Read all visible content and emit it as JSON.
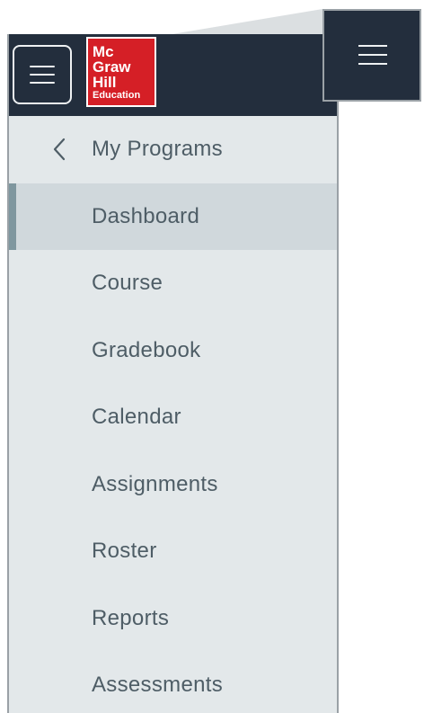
{
  "header": {
    "menu_icon": "hamburger-menu-icon",
    "logo": {
      "line1": "Mc",
      "line2": "Graw",
      "line3": "Hill",
      "line4": "Education",
      "color": "#d51f26"
    },
    "background": "#232e3d"
  },
  "nav": {
    "back": {
      "icon": "chevron-left-icon",
      "label": "My Programs"
    },
    "items": [
      {
        "label": "Dashboard",
        "active": true
      },
      {
        "label": "Course",
        "active": false
      },
      {
        "label": "Gradebook",
        "active": false
      },
      {
        "label": "Calendar",
        "active": false
      },
      {
        "label": "Assignments",
        "active": false
      },
      {
        "label": "Roster",
        "active": false
      },
      {
        "label": "Reports",
        "active": false
      },
      {
        "label": "Assessments",
        "active": false
      }
    ]
  },
  "callout": {
    "icon": "hamburger-menu-icon"
  },
  "colors": {
    "sidebar_bg": "#e3e8ea",
    "active_bg": "#d0d8dc",
    "active_indicator": "#7f979f",
    "text": "#4e5d66"
  }
}
